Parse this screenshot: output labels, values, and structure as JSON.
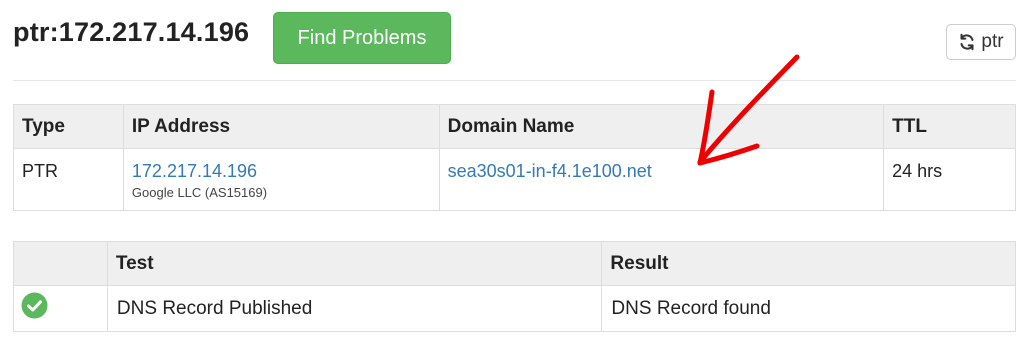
{
  "header": {
    "query": "ptr:172.217.14.196",
    "find_problems_label": "Find Problems",
    "refresh_label": "ptr",
    "refresh_icon": "refresh-icon"
  },
  "records": {
    "columns": [
      "Type",
      "IP Address",
      "Domain Name",
      "TTL"
    ],
    "rows": [
      {
        "type": "PTR",
        "ip": "172.217.14.196",
        "owner": "Google LLC (AS15169)",
        "domain": "sea30s01-in-f4.1e100.net",
        "ttl": "24 hrs"
      }
    ]
  },
  "tests": {
    "columns": [
      "",
      "Test",
      "Result"
    ],
    "rows": [
      {
        "status_icon": "check-circle-icon",
        "test": "DNS Record Published",
        "result": "DNS Record found"
      }
    ]
  },
  "colors": {
    "success": "#5cb85c",
    "link": "#337ab7",
    "annotation_arrow": "#ee0000"
  }
}
